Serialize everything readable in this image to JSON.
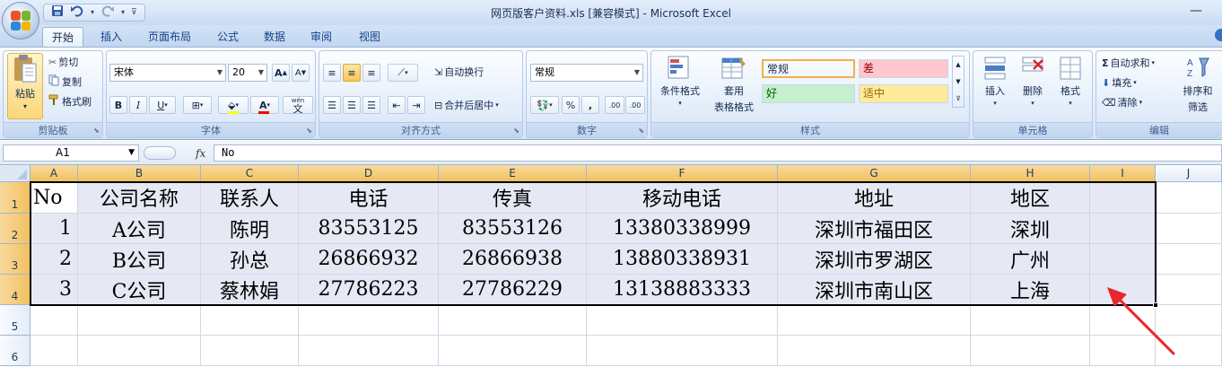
{
  "window": {
    "title": "网页版客户资料.xls  [兼容模式] - Microsoft Excel",
    "minimize_glyph": "—"
  },
  "qat": {
    "save_icon": "save-icon",
    "undo_icon": "undo-icon",
    "redo_icon": "redo-icon",
    "customize_icon": "customize-qat-icon"
  },
  "tabs": [
    "开始",
    "插入",
    "页面布局",
    "公式",
    "数据",
    "审阅",
    "视图"
  ],
  "active_tab": "开始",
  "ribbon": {
    "clipboard": {
      "label": "剪贴板",
      "paste": "粘贴",
      "cut": "剪切",
      "copy": "复制",
      "format_painter": "格式刷"
    },
    "font": {
      "label": "字体",
      "font_name": "宋体",
      "font_size": "20",
      "bold": "B",
      "italic": "I",
      "underline": "U",
      "grow": "A",
      "shrink": "A",
      "font_color_letter": "A",
      "phonetic": "wén",
      "phonetic_char": "文",
      "fill_color": "#ffff00",
      "text_color": "#ff0000"
    },
    "alignment": {
      "label": "对齐方式",
      "wrap_text": "自动换行",
      "merge_center": "合并后居中"
    },
    "number": {
      "label": "数字",
      "format": "常规",
      "percent": "%",
      "comma": ",",
      "increase_decimal": ".00",
      "decrease_decimal": ".00"
    },
    "styles": {
      "label": "样式",
      "conditional": "条件格式",
      "table_format_1": "套用",
      "table_format_2": "表格格式",
      "cells": [
        {
          "text": "常规",
          "bg": "#ffffff",
          "color": "#000000"
        },
        {
          "text": "差",
          "bg": "#ffc7ce",
          "color": "#9c0006"
        },
        {
          "text": "好",
          "bg": "#c6efce",
          "color": "#006100"
        },
        {
          "text": "适中",
          "bg": "#ffeb9c",
          "color": "#9c6500"
        }
      ]
    },
    "cells_group": {
      "label": "单元格",
      "insert": "插入",
      "delete": "删除",
      "format": "格式"
    },
    "editing": {
      "label": "编辑",
      "autosum": "自动求和",
      "fill": "填充",
      "clear": "清除",
      "sort_filter_1": "排序和",
      "sort_filter_2": "筛选"
    }
  },
  "formula_bar": {
    "name_box": "A1",
    "fx": "fx",
    "formula": "No"
  },
  "sheet": {
    "columns": [
      "A",
      "B",
      "C",
      "D",
      "E",
      "F",
      "G",
      "H",
      "I",
      "J"
    ],
    "rows": [
      "1",
      "2",
      "3",
      "4",
      "5",
      "6"
    ],
    "data": [
      [
        "No",
        "公司名称",
        "联系人",
        "电话",
        "传真",
        "移动电话",
        "地址",
        "地区"
      ],
      [
        "1",
        "A公司",
        "陈明",
        "83553125",
        "83553126",
        "13380338999",
        "深圳市福田区",
        "深圳"
      ],
      [
        "2",
        "B公司",
        "孙总",
        "26866932",
        "26866938",
        "13880338931",
        "深圳市罗湖区",
        "广州"
      ],
      [
        "3",
        "C公司",
        "蔡林娟",
        "27786223",
        "27786229",
        "13138883333",
        "深圳市南山区",
        "上海"
      ]
    ],
    "selection_fill": "#e6e9f4",
    "annotation_color": "#e8272a"
  }
}
